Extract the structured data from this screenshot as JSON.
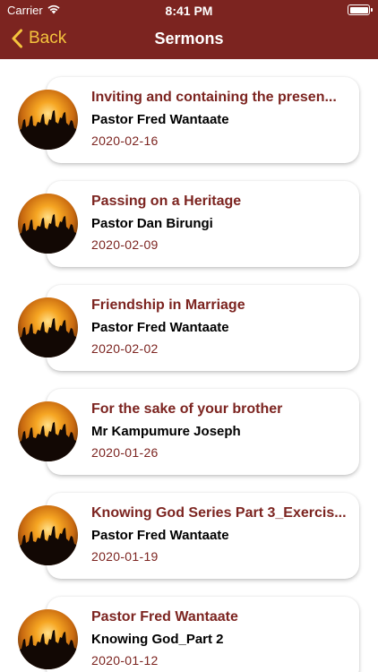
{
  "status": {
    "carrier": "Carrier",
    "time": "8:41 PM"
  },
  "nav": {
    "back_label": "Back",
    "title": "Sermons"
  },
  "colors": {
    "bar": "#7c2420",
    "accent": "#f5c43d",
    "title_text": "#7c2420"
  },
  "sermons": [
    {
      "title": "Inviting and containing the presen...",
      "speaker": "Pastor Fred Wantaate",
      "date": "2020-02-16"
    },
    {
      "title": "Passing on a Heritage",
      "speaker": "Pastor Dan Birungi",
      "date": "2020-02-09"
    },
    {
      "title": "Friendship in Marriage",
      "speaker": "Pastor Fred Wantaate",
      "date": "2020-02-02"
    },
    {
      "title": "For the sake of your brother",
      "speaker": "Mr Kampumure Joseph",
      "date": "2020-01-26"
    },
    {
      "title": "Knowing God Series Part 3_Exercis...",
      "speaker": "Pastor Fred Wantaate",
      "date": "2020-01-19"
    },
    {
      "title": "Pastor Fred Wantaate",
      "speaker": "Knowing God_Part 2",
      "date": "2020-01-12"
    }
  ]
}
